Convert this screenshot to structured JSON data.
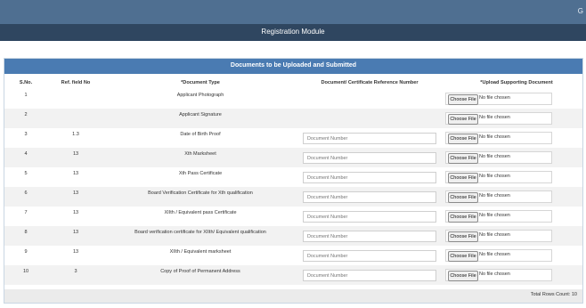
{
  "header": {
    "corner_glyph": "G",
    "title": "Registration Module"
  },
  "panel": {
    "title": "Documents to be Uploaded and Submitted",
    "columns": [
      "S.No.",
      "Ref. field No",
      "*Document Type",
      "Document/ Certificate Reference Number",
      "*Upload Supporting Document"
    ],
    "doc_number_placeholder": "Document Number",
    "choose_file_label": "Choose File",
    "no_file_text": "No file chosen",
    "rows": [
      {
        "sno": "1",
        "ref": "",
        "type": "Applicant Photograph",
        "has_docnum": false
      },
      {
        "sno": "2",
        "ref": "",
        "type": "Applicant Signature",
        "has_docnum": false
      },
      {
        "sno": "3",
        "ref": "1.3",
        "type": "Date of Birth Proof",
        "has_docnum": true
      },
      {
        "sno": "4",
        "ref": "13",
        "type": "Xth Marksheet",
        "has_docnum": true
      },
      {
        "sno": "5",
        "ref": "13",
        "type": "Xth Pass Certificate",
        "has_docnum": true
      },
      {
        "sno": "6",
        "ref": "13",
        "type": "Board Verification Certificate for Xth qualification",
        "has_docnum": true
      },
      {
        "sno": "7",
        "ref": "13",
        "type": "XIIth / Equivalent pass Certificate",
        "has_docnum": true
      },
      {
        "sno": "8",
        "ref": "13",
        "type": "Board verification certificate for XIIth/ Equivalent qualification",
        "has_docnum": true
      },
      {
        "sno": "9",
        "ref": "13",
        "type": "XIIth / Equivalent marksheet",
        "has_docnum": true
      },
      {
        "sno": "10",
        "ref": "3",
        "type": "Copy of Proof of Permanent Address",
        "has_docnum": true
      }
    ],
    "footer_text": "Total Rows Count: 10"
  }
}
